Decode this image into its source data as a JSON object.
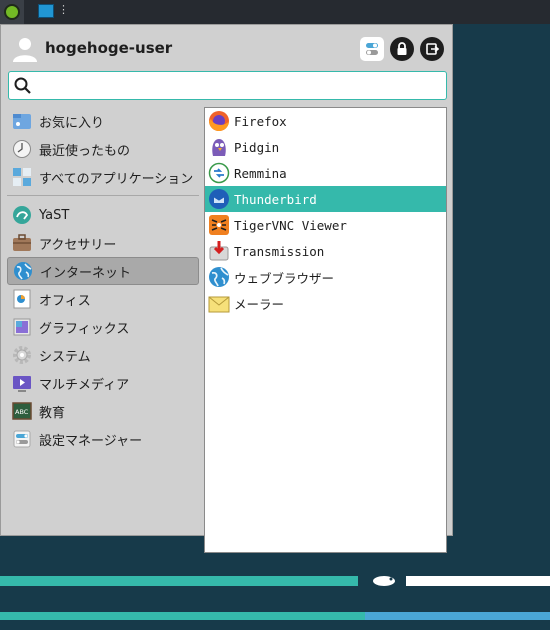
{
  "panel": {
    "desktop_label": "⋮"
  },
  "user": {
    "name": "hogehoge-user"
  },
  "search": {
    "placeholder": "",
    "value": ""
  },
  "categories": [
    {
      "label": "お気に入り",
      "icon": "favorites-icon"
    },
    {
      "label": "最近使ったもの",
      "icon": "clock-icon"
    },
    {
      "label": "すべてのアプリケーション",
      "icon": "all-apps-icon"
    },
    {
      "label": "YaST",
      "icon": "yast-icon"
    },
    {
      "label": "アクセサリー",
      "icon": "briefcase-icon"
    },
    {
      "label": "インターネット",
      "icon": "globe-icon",
      "selected": true
    },
    {
      "label": "オフィス",
      "icon": "office-icon"
    },
    {
      "label": "グラフィックス",
      "icon": "graphics-icon"
    },
    {
      "label": "システム",
      "icon": "gear-icon"
    },
    {
      "label": "マルチメディア",
      "icon": "multimedia-icon"
    },
    {
      "label": "教育",
      "icon": "education-icon"
    },
    {
      "label": "設定マネージャー",
      "icon": "settings-icon"
    }
  ],
  "apps": [
    {
      "label": "Firefox",
      "icon": "firefox-icon"
    },
    {
      "label": "Pidgin",
      "icon": "pidgin-icon"
    },
    {
      "label": "Remmina",
      "icon": "remmina-icon"
    },
    {
      "label": "Thunderbird",
      "icon": "thunderbird-icon",
      "selected": true
    },
    {
      "label": "TigerVNC Viewer",
      "icon": "tigervnc-icon"
    },
    {
      "label": "Transmission",
      "icon": "transmission-icon"
    },
    {
      "label": "ウェブブラウザー",
      "icon": "web-browser-icon"
    },
    {
      "label": "メーラー",
      "icon": "mail-icon"
    }
  ],
  "colors": {
    "accent": "#35b9ab",
    "desktop": "#173a4a",
    "menu_bg": "#d0d0d0"
  }
}
